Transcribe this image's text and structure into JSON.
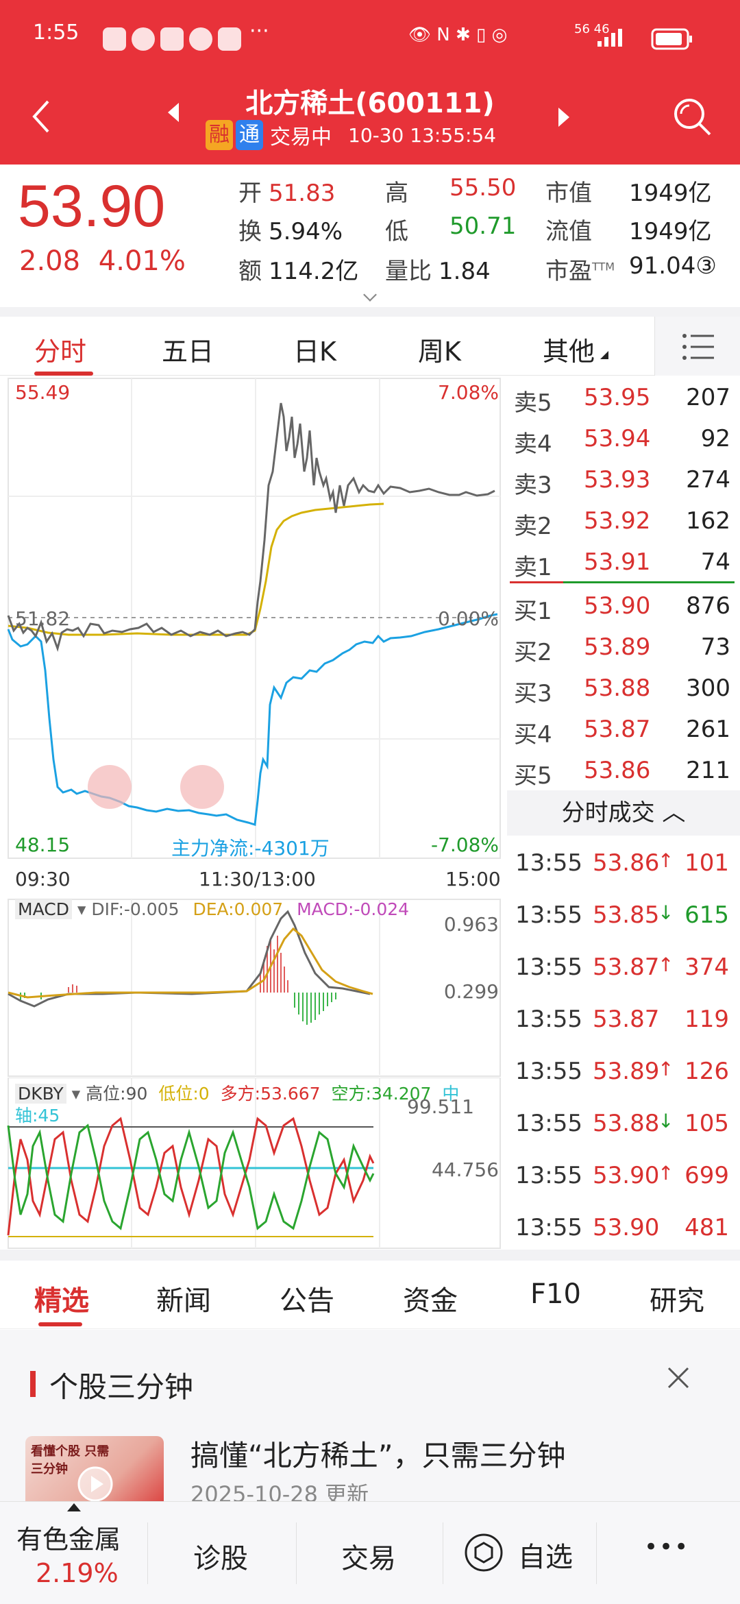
{
  "status": {
    "time": "1:55",
    "signal_text": "56 46"
  },
  "header": {
    "title": "北方稀土(600111)",
    "badge1": "融",
    "badge2": "通",
    "trading_status": "交易中",
    "datetime": "10-30 13:55:54",
    "colors": {
      "bar": "#e8323a",
      "badge1": "#f5a623",
      "badge2": "#2f80ed"
    }
  },
  "quote": {
    "price": "53.90",
    "change": "2.08",
    "change_pct": "4.01%",
    "open_label": "开",
    "open": "51.83",
    "high_label": "高",
    "high": "55.50",
    "mktcap_label": "市值",
    "mktcap": "1949亿",
    "turnover_label": "换",
    "turnover": "5.94%",
    "low_label": "低",
    "low": "50.71",
    "float_label": "流值",
    "float": "1949亿",
    "amount_label": "额",
    "amount": "114.2亿",
    "volratio_label": "量比",
    "volratio": "1.84",
    "pe_label": "市盈",
    "pe_sup": "TTM",
    "pe": "91.04③"
  },
  "chart_tabs": [
    "分时",
    "五日",
    "日K",
    "周K",
    "其他"
  ],
  "price_chart": {
    "y_max": "55.49",
    "y_ref": "51.82",
    "y_min": "48.15",
    "pct_max": "7.08%",
    "pct_ref": "0.00%",
    "pct_min": "-7.08%",
    "flow_label": "主力净流:-4301万",
    "times": [
      "09:30",
      "11:30/13:00",
      "15:00"
    ]
  },
  "macd": {
    "name": "MACD",
    "dif": "DIF:-0.005",
    "dea": "DEA:0.007",
    "macd": "MACD:-0.024",
    "y1": "0.963",
    "y2": "0.299"
  },
  "dkby": {
    "name": "DKBY",
    "high": "高位:90",
    "low": "低位:0",
    "long": "多方:53.667",
    "short": "空方:34.207",
    "mid_a": "中",
    "mid_b": "轴:45",
    "y1": "99.511",
    "y2": "44.756"
  },
  "orderbook": {
    "asks": [
      {
        "label": "卖5",
        "price": "53.95",
        "vol": "207"
      },
      {
        "label": "卖4",
        "price": "53.94",
        "vol": "92"
      },
      {
        "label": "卖3",
        "price": "53.93",
        "vol": "274"
      },
      {
        "label": "卖2",
        "price": "53.92",
        "vol": "162"
      },
      {
        "label": "卖1",
        "price": "53.91",
        "vol": "74"
      }
    ],
    "bids": [
      {
        "label": "买1",
        "price": "53.90",
        "vol": "876"
      },
      {
        "label": "买2",
        "price": "53.89",
        "vol": "73"
      },
      {
        "label": "买3",
        "price": "53.88",
        "vol": "300"
      },
      {
        "label": "买4",
        "price": "53.87",
        "vol": "261"
      },
      {
        "label": "买5",
        "price": "53.86",
        "vol": "211"
      }
    ]
  },
  "trades": {
    "header": "分时成交 ︿",
    "rows": [
      {
        "time": "13:55",
        "price": "53.86",
        "dir": "↑",
        "vol": "101",
        "color": "red"
      },
      {
        "time": "13:55",
        "price": "53.85",
        "dir": "↓",
        "vol": "615",
        "color": "green"
      },
      {
        "time": "13:55",
        "price": "53.87",
        "dir": "↑",
        "vol": "374",
        "color": "red"
      },
      {
        "time": "13:55",
        "price": "53.87",
        "dir": "",
        "vol": "119",
        "color": "red"
      },
      {
        "time": "13:55",
        "price": "53.89",
        "dir": "↑",
        "vol": "126",
        "color": "red"
      },
      {
        "time": "13:55",
        "price": "53.88",
        "dir": "↓",
        "vol": "105",
        "color": "red"
      },
      {
        "time": "13:55",
        "price": "53.90",
        "dir": "↑",
        "vol": "699",
        "color": "red"
      },
      {
        "time": "13:55",
        "price": "53.90",
        "dir": "",
        "vol": "481",
        "color": "red"
      }
    ]
  },
  "news_tabs": [
    "精选",
    "新闻",
    "公告",
    "资金",
    "F10",
    "研究"
  ],
  "section": {
    "title": "个股三分钟"
  },
  "article": {
    "title": "搞懂“北方稀土”，只需三分钟",
    "date": "2025-10-28 更新",
    "thumb_text": "看懂个股 只需三分钟"
  },
  "bottom": {
    "sector": "有色金属",
    "sector_pct": "2.19%",
    "diagnose": "诊股",
    "trade": "交易",
    "watchlist": "自选",
    "more": "•••"
  }
}
